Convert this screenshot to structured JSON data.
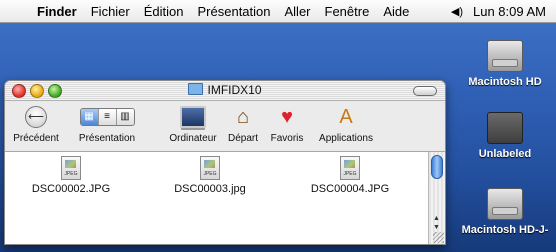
{
  "menubar": {
    "apple": "",
    "items": [
      "Finder",
      "Fichier",
      "Édition",
      "Présentation",
      "Aller",
      "Fenêtre",
      "Aide"
    ],
    "volume": "◀)",
    "clock": "Lun 8:09 AM"
  },
  "desktop": {
    "icons": [
      {
        "label": "Macintosh HD"
      },
      {
        "label": "Unlabeled"
      },
      {
        "label": "Macintosh HD-J-"
      }
    ]
  },
  "window": {
    "title": "IMFIDX10",
    "toolbar": {
      "back_label": "Précédent",
      "view_label": "Présentation",
      "view_segments": [
        "▦",
        "≡",
        "▥"
      ],
      "places": [
        {
          "label": "Ordinateur",
          "icon": "computer-icon"
        },
        {
          "label": "Départ",
          "icon": "home-icon"
        },
        {
          "label": "Favoris",
          "icon": "favorites-heart-icon"
        },
        {
          "label": "Applications",
          "icon": "applications-icon"
        }
      ]
    },
    "files": [
      {
        "name": "DSC00002.JPG",
        "badge": "JPEG"
      },
      {
        "name": "DSC00003.jpg",
        "badge": "JPEG"
      },
      {
        "name": "DSC00004.JPG",
        "badge": "JPEG"
      }
    ]
  },
  "colors": {
    "desktop": "#2f5fb4",
    "accent": "#4a88d8"
  }
}
